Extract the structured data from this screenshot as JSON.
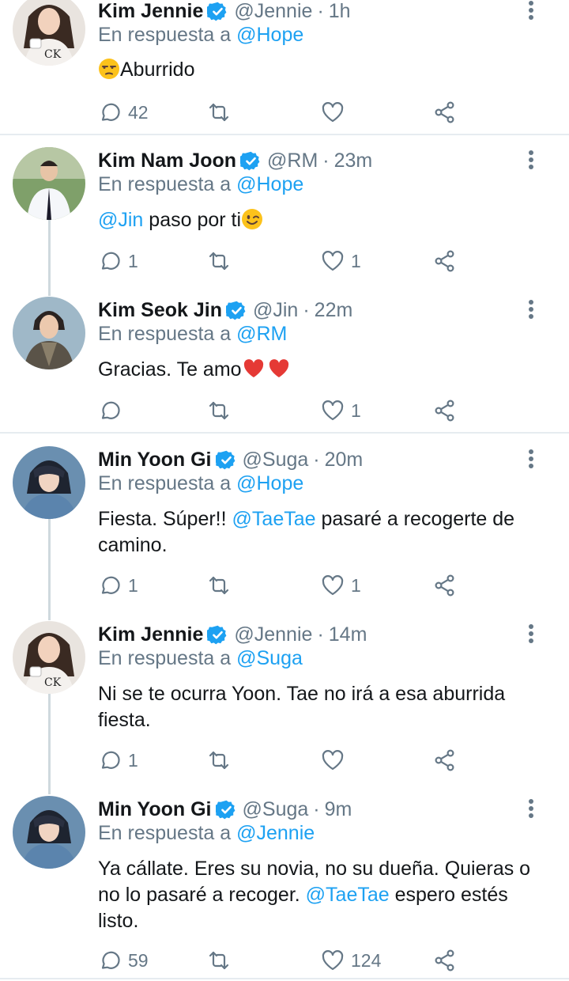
{
  "reply_prefix": "En respuesta a",
  "colors": {
    "link": "#1da1f2",
    "muted": "#657786",
    "text": "#14171a",
    "divider": "#e6ecf0"
  },
  "tweets": [
    {
      "name": "Kim Jennie",
      "handle": "@Jennie",
      "time": "1h",
      "reply_to": "@Hope",
      "text_emoji": "unamused-emoji",
      "text_after": "Aburrido",
      "replies": "42",
      "retweets": "",
      "likes": ""
    },
    {
      "name": "Kim Nam Joon",
      "handle": "@RM",
      "time": "23m",
      "reply_to": "@Hope",
      "mention": "@Jin",
      "text_after": " paso por ti",
      "text_emoji": "winking-emoji",
      "replies": "1",
      "retweets": "",
      "likes": "1"
    },
    {
      "name": "Kim Seok Jin",
      "handle": "@Jin",
      "time": "22m",
      "reply_to": "@RM",
      "text_before": "Gracias. Te amo",
      "text_emoji": "two-red-hearts-emoji",
      "replies": "",
      "retweets": "",
      "likes": "1"
    },
    {
      "name": "Min Yoon Gi",
      "handle": "@Suga",
      "time": "20m",
      "reply_to": "@Hope",
      "text_before": "Fiesta. Súper!! ",
      "mention": "@TaeTae",
      "text_after": " pasaré a recogerte de camino.",
      "replies": "1",
      "retweets": "",
      "likes": "1"
    },
    {
      "name": "Kim Jennie",
      "handle": "@Jennie",
      "time": "14m",
      "reply_to": "@Suga",
      "text_before": "Ni se te ocurra Yoon. Tae no irá a esa aburrida fiesta.",
      "replies": "1",
      "retweets": "",
      "likes": ""
    },
    {
      "name": "Min Yoon Gi",
      "handle": "@Suga",
      "time": "9m",
      "reply_to": "@Jennie",
      "text_before": "Ya cállate. Eres su novia, no su dueña. Quieras o no lo pasaré a recoger. ",
      "mention": "@TaeTae",
      "text_after": " espero estés listo.",
      "replies": "59",
      "retweets": "",
      "likes": "124"
    }
  ]
}
